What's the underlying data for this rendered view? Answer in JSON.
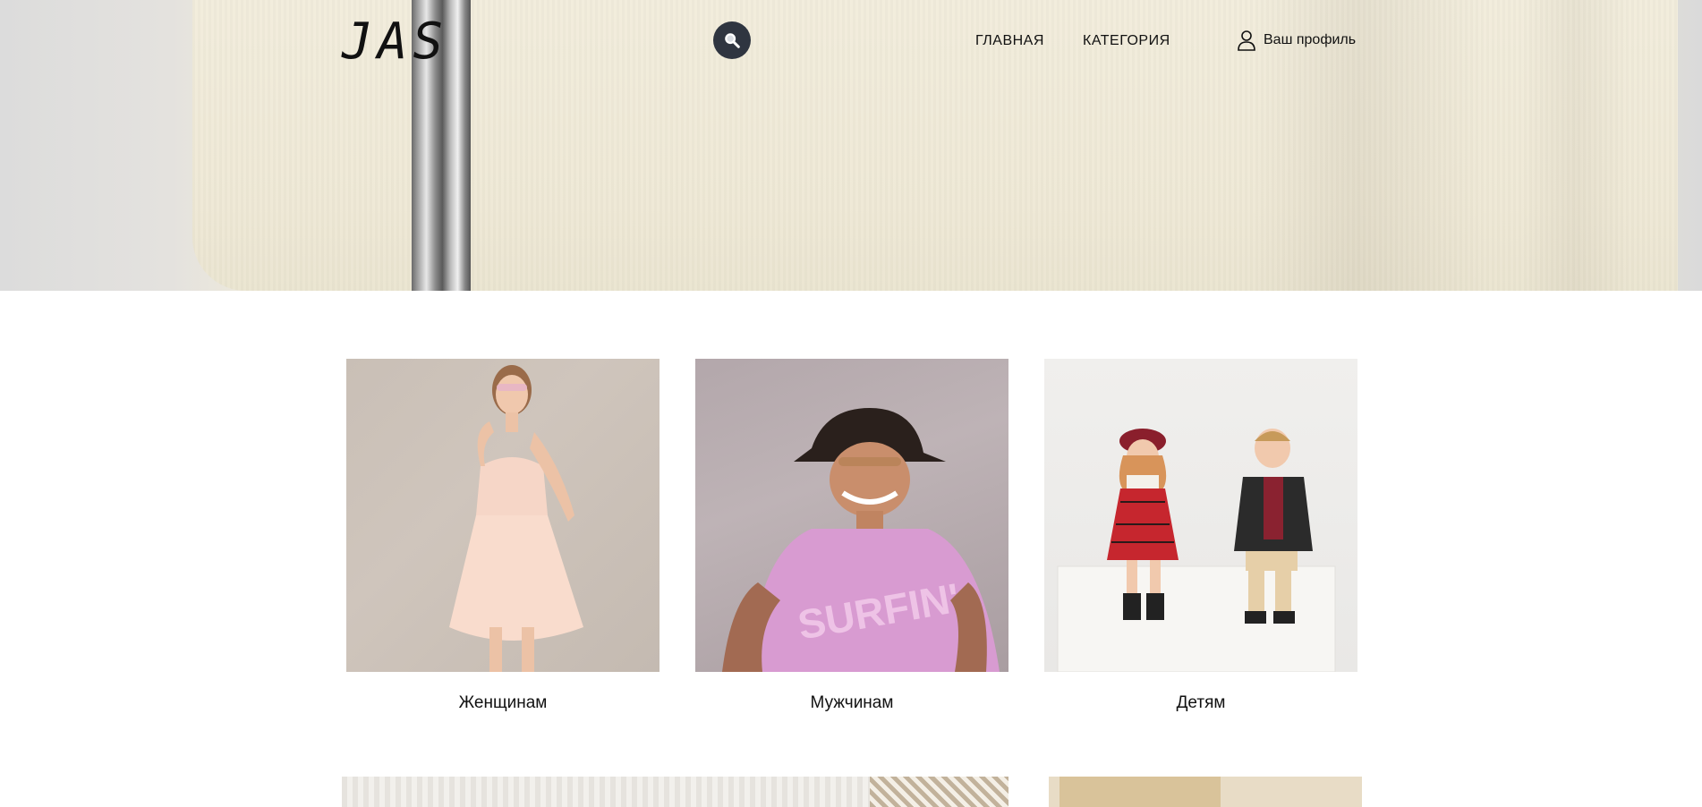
{
  "header": {
    "logo": "JAS",
    "search_icon": "search-icon",
    "nav": [
      {
        "label": "ГЛАВНАЯ"
      },
      {
        "label": "КАТЕГОРИЯ"
      }
    ],
    "profile": {
      "label": "Ваш профиль",
      "icon": "user-icon"
    }
  },
  "categories": [
    {
      "label": "Женщинам"
    },
    {
      "label": "Мужчинам"
    },
    {
      "label": "Детям"
    }
  ],
  "colors": {
    "search_button": "#2f3540",
    "text": "#111111",
    "background": "#ffffff"
  }
}
